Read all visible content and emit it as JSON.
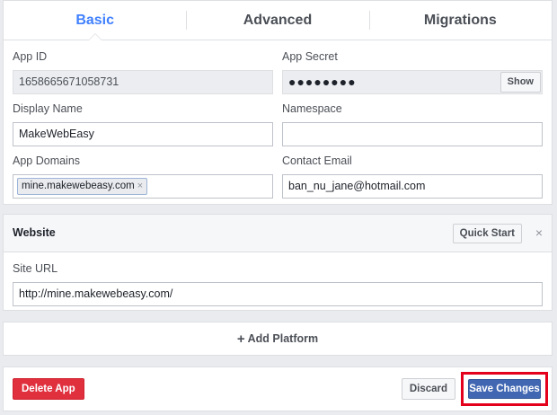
{
  "tabs": [
    {
      "label": "Basic",
      "active": true
    },
    {
      "label": "Advanced",
      "active": false
    },
    {
      "label": "Migrations",
      "active": false
    }
  ],
  "basic": {
    "app_id": {
      "label": "App ID",
      "value": "1658665671058731"
    },
    "app_secret": {
      "label": "App Secret",
      "value": "●●●●●●●●",
      "show_label": "Show"
    },
    "display_name": {
      "label": "Display Name",
      "value": "MakeWebEasy"
    },
    "namespace": {
      "label": "Namespace",
      "value": ""
    },
    "app_domains": {
      "label": "App Domains",
      "tokens": [
        "mine.makewebeasy.com"
      ],
      "remove_glyph": "×"
    },
    "contact_email": {
      "label": "Contact Email",
      "value": "ban_nu_jane@hotmail.com"
    }
  },
  "website": {
    "title": "Website",
    "quick_start_label": "Quick Start",
    "close_glyph": "×",
    "site_url": {
      "label": "Site URL",
      "value": "http://mine.makewebeasy.com/"
    }
  },
  "add_platform": {
    "plus": "+",
    "label": "Add Platform"
  },
  "footer": {
    "delete_label": "Delete App",
    "discard_label": "Discard",
    "save_label": "Save Changes"
  },
  "colors": {
    "accent": "#4080ff",
    "primary_button": "#4267b2",
    "danger_button": "#e0303e",
    "highlight": "#e4001b"
  }
}
